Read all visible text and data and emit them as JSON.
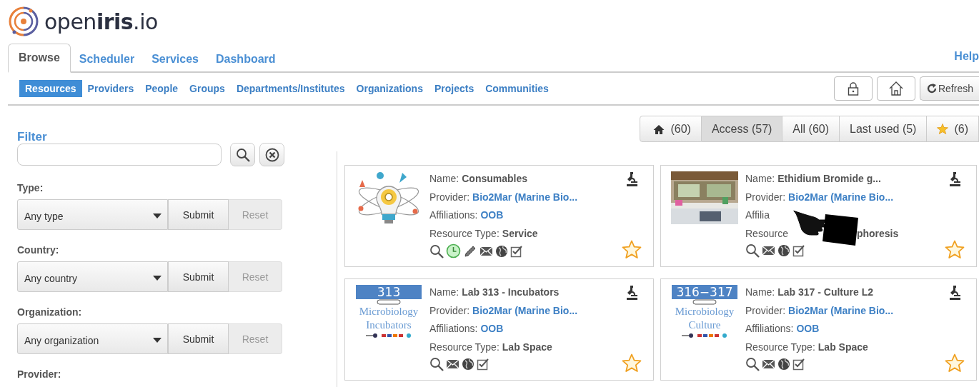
{
  "logo": {
    "text": "open**iris**.io"
  },
  "main_tabs": [
    {
      "label": "Browse",
      "selected": true
    },
    {
      "label": "Scheduler",
      "selected": false
    },
    {
      "label": "Services",
      "selected": false
    },
    {
      "label": "Dashboard",
      "selected": false
    }
  ],
  "help": "Help",
  "sub_tabs": [
    {
      "label": "Resources",
      "selected": true
    },
    {
      "label": "Providers",
      "selected": false
    },
    {
      "label": "People",
      "selected": false
    },
    {
      "label": "Groups",
      "selected": false
    },
    {
      "label": "Departments/Institutes",
      "selected": false
    },
    {
      "label": "Organizations",
      "selected": false
    },
    {
      "label": "Projects",
      "selected": false
    },
    {
      "label": "Communities",
      "selected": false
    }
  ],
  "toolbar": [
    {
      "kind": "lock"
    },
    {
      "kind": "home"
    },
    {
      "kind": "refresh",
      "label": "Refresh"
    }
  ],
  "filter": {
    "title": "Filter",
    "groups": [
      {
        "label": "Type:",
        "value": "Any type",
        "submit": "Submit",
        "reset": {
          "label": "Reset",
          "disabled": true
        }
      },
      {
        "label": "Country:",
        "value": "Any country",
        "submit": "Submit",
        "reset": {
          "label": "Reset",
          "disabled": true
        }
      },
      {
        "label": "Organization:",
        "value": "Any organization",
        "submit": "Submit",
        "reset": {
          "label": "Reset",
          "disabled": true
        }
      }
    ],
    "next_label": "Provider:"
  },
  "views": [
    {
      "kind": "home",
      "label": "(60)",
      "selected": false
    },
    {
      "kind": "text",
      "label": "Access (57)",
      "selected": true
    },
    {
      "kind": "text",
      "label": "All (60)",
      "selected": false
    },
    {
      "kind": "text",
      "label": "Last used (5)",
      "selected": false
    },
    {
      "kind": "star",
      "label": "(6)",
      "selected": false
    }
  ],
  "cards": [
    {
      "thumb": {
        "kind": "illustration"
      },
      "fields": [
        {
          "label": "Name:",
          "value": "Consumables",
          "link": false
        },
        {
          "label": "Provider:",
          "value": "Bio2Mar (Marine Bio...",
          "link": true
        },
        {
          "label": "Affiliations:",
          "value": "OOB",
          "link": true
        },
        {
          "label": "Resource Type:",
          "value": "Service",
          "link": false
        }
      ],
      "actions": [
        {
          "kind": "search"
        },
        {
          "kind": "clock"
        },
        {
          "kind": "pencil"
        },
        {
          "kind": "mail"
        },
        {
          "kind": "globe"
        },
        {
          "kind": "check"
        }
      ],
      "favorite": false
    },
    {
      "thumb": {
        "kind": "picture"
      },
      "fields": [
        {
          "label": "Name:",
          "value": "Ethidium Bromide g...",
          "link": false
        },
        {
          "label": "Provider:",
          "value": "Bio2Mar (Marine Bio...",
          "link": true
        },
        {
          "label": "Affilia",
          "covered": true
        },
        {
          "label": "Resource",
          "value": "phoresis",
          "link": false,
          "covered": true
        }
      ],
      "actions": [
        {
          "kind": "search"
        },
        {
          "kind": "mail"
        },
        {
          "kind": "globe"
        },
        {
          "kind": "check"
        }
      ],
      "favorite": false,
      "pointer": true
    },
    {
      "thumb": {
        "kind": "label",
        "number": "313",
        "lines": [
          "Microbiology",
          "Incubators"
        ]
      },
      "fields": [
        {
          "label": "Name:",
          "value": "Lab 313 - Incubators",
          "link": false
        },
        {
          "label": "Provider:",
          "value": "Bio2Mar (Marine Bio...",
          "link": true
        },
        {
          "label": "Affiliations:",
          "value": "OOB",
          "link": true
        },
        {
          "label": "Resource Type:",
          "value": "Lab Space",
          "link": false
        }
      ],
      "actions": [
        {
          "kind": "search"
        },
        {
          "kind": "mail"
        },
        {
          "kind": "globe"
        },
        {
          "kind": "check"
        }
      ],
      "favorite": false
    },
    {
      "thumb": {
        "kind": "label",
        "number": "316−317",
        "lines": [
          "Microbiology",
          "Culture"
        ]
      },
      "fields": [
        {
          "label": "Name:",
          "value": "Lab 317 - Culture L2",
          "link": false
        },
        {
          "label": "Provider:",
          "value": "Bio2Mar (Marine Bio...",
          "link": true
        },
        {
          "label": "Affiliations:",
          "value": "OOB",
          "link": true
        },
        {
          "label": "Resource Type:",
          "value": "Lab Space",
          "link": false
        }
      ],
      "actions": [
        {
          "kind": "search"
        },
        {
          "kind": "mail"
        },
        {
          "kind": "globe"
        },
        {
          "kind": "check"
        }
      ],
      "favorite": false
    }
  ]
}
